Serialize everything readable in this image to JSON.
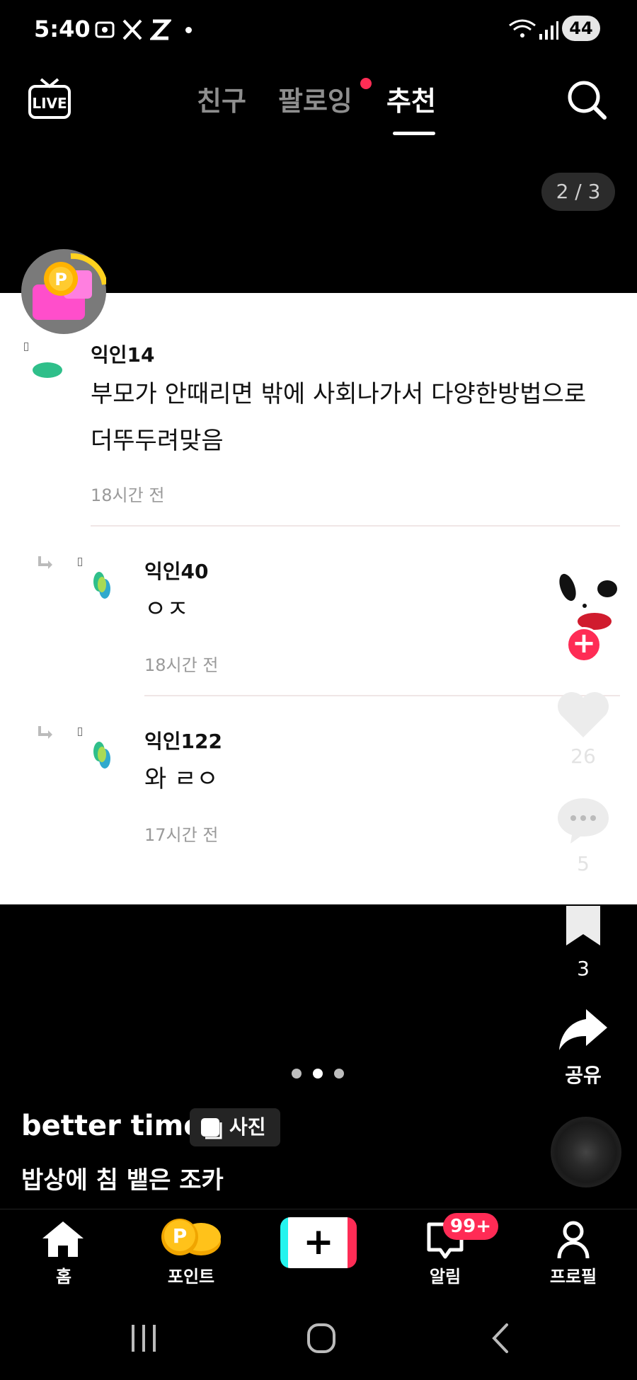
{
  "status_bar": {
    "time": "5:40",
    "battery": "44",
    "notification_icons": [
      "screenshot-icon",
      "x-icon",
      "z-icon",
      "dot-icon"
    ]
  },
  "top_nav": {
    "live_label": "LIVE",
    "tabs": [
      {
        "label": "친구",
        "active": false
      },
      {
        "label": "팔로잉",
        "active": false,
        "has_dot": true
      },
      {
        "label": "추천",
        "active": true
      }
    ]
  },
  "page_indicator": "2 / 3",
  "comments": [
    {
      "user": "익인14",
      "text_line1": "부모가 안때리면 밖에 사회나가서 다양한방법으로",
      "text_line2": "더뚜두려맞음",
      "time": "18시간 전"
    },
    {
      "user": "익인40",
      "text": "ㅇㅈ",
      "time": "18시간 전",
      "reply": true
    },
    {
      "user": "익인122",
      "text": "와 ㄹㅇ",
      "time": "17시간 전",
      "reply": true
    }
  ],
  "actions": {
    "likes": "26",
    "comments": "5",
    "saves": "3",
    "share_label": "공유"
  },
  "post": {
    "author": "better time",
    "photo_badge": "사진",
    "caption": "밥상에 침 뱉은 조카"
  },
  "bottom_nav": {
    "items": [
      {
        "label": "홈"
      },
      {
        "label": "포인트"
      },
      {
        "label": ""
      },
      {
        "label": "알림",
        "badge": "99+"
      },
      {
        "label": "프로필"
      }
    ]
  },
  "colors": {
    "accent_red": "#ff2d55",
    "card_bg": "#ffffff",
    "bg": "#000000"
  }
}
